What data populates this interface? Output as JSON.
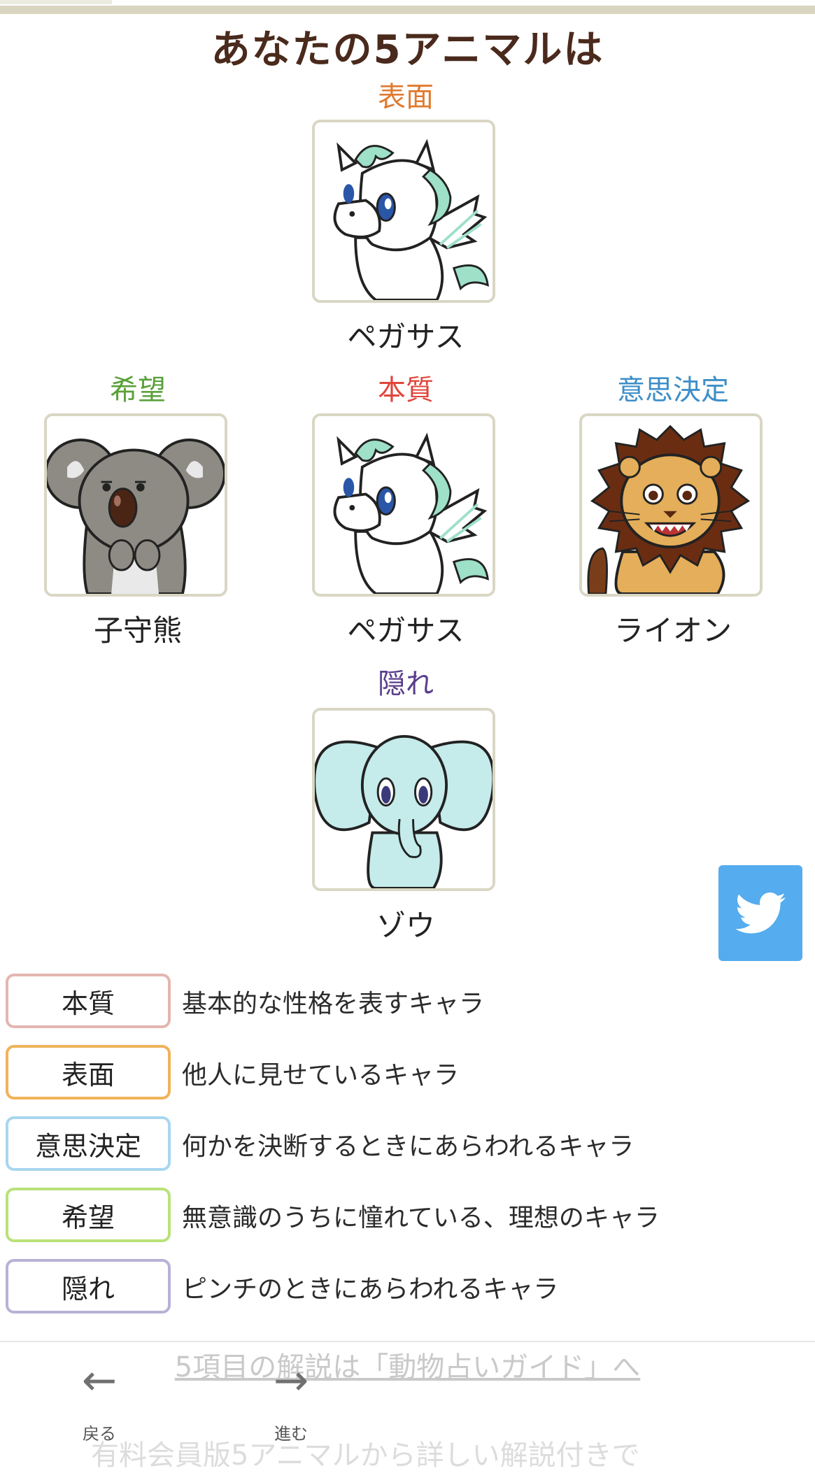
{
  "title": "あなたの5アニマルは",
  "categories": {
    "surface": {
      "label": "表面",
      "animal": "ペガサス",
      "color": "#e07a2e"
    },
    "hope": {
      "label": "希望",
      "animal": "子守熊",
      "color": "#5aa13a"
    },
    "essence": {
      "label": "本質",
      "animal": "ペガサス",
      "color": "#e0463c"
    },
    "decision": {
      "label": "意思決定",
      "animal": "ライオン",
      "color": "#3e8fc8"
    },
    "hidden": {
      "label": "隠れ",
      "animal": "ゾウ",
      "color": "#5a3f8c"
    }
  },
  "legend": [
    {
      "label": "本質",
      "desc": "基本的な性格を表すキャラ",
      "border": "#e3b6b0"
    },
    {
      "label": "表面",
      "desc": "他人に見せているキャラ",
      "border": "#f0b35a"
    },
    {
      "label": "意思決定",
      "desc": "何かを決断するときにあらわれるキャラ",
      "border": "#a8d6ef"
    },
    {
      "label": "希望",
      "desc": "無意識のうちに憧れている、理想のキャラ",
      "border": "#b8e27a"
    },
    {
      "label": "隠れ",
      "desc": "ピンチのときにあらわれるキャラ",
      "border": "#b8b2d6"
    }
  ],
  "bottom_link": "5項目の解説は「動物占いガイド」へ",
  "nav": {
    "back": "戻る",
    "forward": "進む"
  },
  "cut_text": "有料会員版5アニマルから詳しい解説付きで",
  "icons": {
    "share": "twitter-icon",
    "back": "arrow-left-icon",
    "forward": "arrow-right-icon"
  }
}
